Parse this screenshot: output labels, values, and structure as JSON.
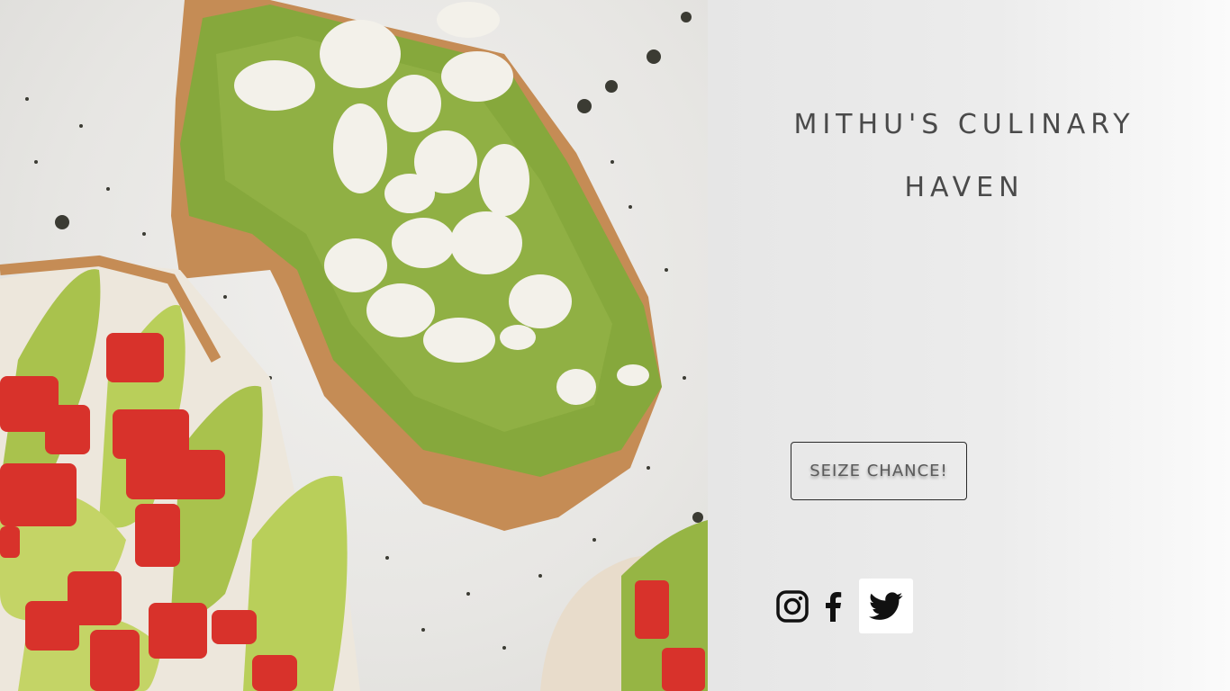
{
  "brand": {
    "line1": "MITHU'S CULINARY",
    "line2": "HAVEN"
  },
  "cta": {
    "label": "SEIZE CHANCE!"
  },
  "social": {
    "items": [
      {
        "name": "instagram",
        "icon": "instagram-icon"
      },
      {
        "name": "facebook",
        "icon": "facebook-icon"
      },
      {
        "name": "twitter",
        "icon": "twitter-icon"
      }
    ]
  },
  "colors": {
    "panel_bg": "#e6e6e6",
    "text": "#4a4a4a",
    "avocado": "#7fa63a",
    "bread": "#c08a52",
    "tomato": "#d8322b"
  }
}
